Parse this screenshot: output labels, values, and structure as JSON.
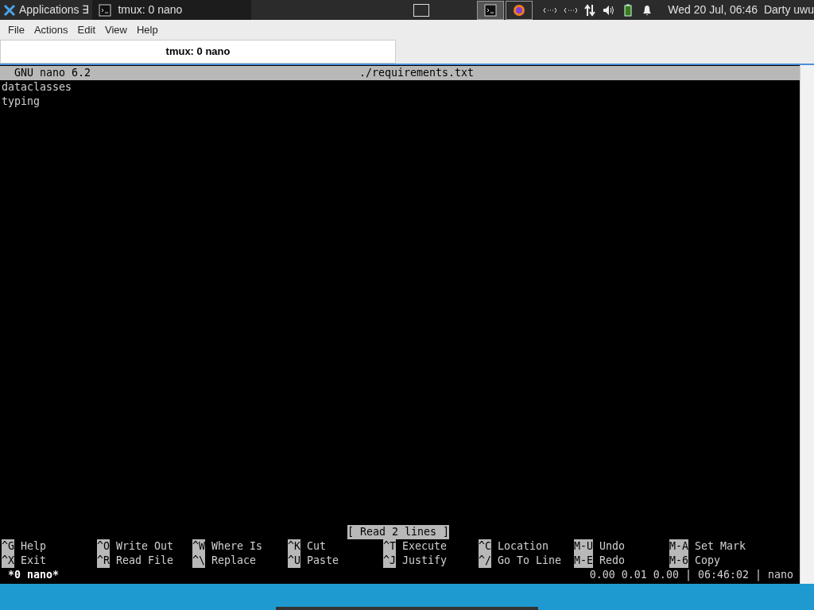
{
  "panel": {
    "applications": "Applications",
    "applications_suffix": "∃",
    "windows": [
      {
        "title": "tmux: 0 nano",
        "selected": true
      }
    ],
    "clock": "Wed 20 Jul, 06:46",
    "user": "Darty uwu"
  },
  "menu": [
    "File",
    "Actions",
    "Edit",
    "View",
    "Help"
  ],
  "tabs": [
    {
      "label": "tmux: 0 nano",
      "selected": true
    }
  ],
  "nano": {
    "version": "GNU nano 6.2",
    "filename": "./requirements.txt",
    "lines": [
      "dataclasses",
      "typing"
    ],
    "message": "[ Read 2 lines ]",
    "shortcuts": [
      [
        {
          "key": "^G",
          "label": "Help"
        },
        {
          "key": "^O",
          "label": "Write Out"
        },
        {
          "key": "^W",
          "label": "Where Is"
        },
        {
          "key": "^K",
          "label": "Cut"
        },
        {
          "key": "^T",
          "label": "Execute"
        },
        {
          "key": "^C",
          "label": "Location"
        },
        {
          "key": "M-U",
          "label": "Undo"
        },
        {
          "key": "M-A",
          "label": "Set Mark"
        }
      ],
      [
        {
          "key": "^X",
          "label": "Exit"
        },
        {
          "key": "^R",
          "label": "Read File"
        },
        {
          "key": "^\\",
          "label": "Replace"
        },
        {
          "key": "^U",
          "label": "Paste"
        },
        {
          "key": "^J",
          "label": "Justify"
        },
        {
          "key": "^/",
          "label": "Go To Line"
        },
        {
          "key": "M-E",
          "label": "Redo"
        },
        {
          "key": "M-6",
          "label": "Copy"
        }
      ]
    ]
  },
  "tmux": {
    "window": "*0 nano*",
    "status": "0.00 0.01 0.00 | 06:46:02 | nano"
  }
}
